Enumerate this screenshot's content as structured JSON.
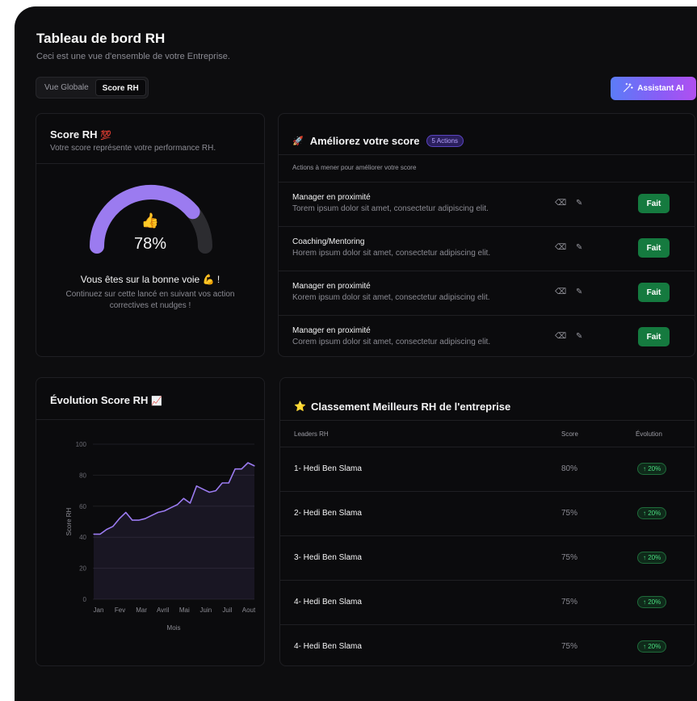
{
  "header": {
    "title": "Tableau de bord RH",
    "subtitle": "Ceci est une vue d'ensemble de votre Entreprise.",
    "tabs": [
      "Vue Globale",
      "Score RH"
    ],
    "active_tab": "Score RH",
    "ai_button": "Assistant AI"
  },
  "score_card": {
    "title": "Score RH",
    "title_emoji": "💯",
    "subtitle": "Votre score représente votre performance RH.",
    "emoji": "👍",
    "value": 78,
    "value_text": "78%",
    "status": "Vous êtes sur la bonne voie 💪 !",
    "message": "Continuez sur cette lancé en suivant vos action correctives et nudges !"
  },
  "actions": {
    "title_emoji": "🚀",
    "title": "Améliorez votre score",
    "badge": "5 Actions",
    "caption": "Actions à mener pour améliorer votre score",
    "done_label": "Fait",
    "items": [
      {
        "name": "Manager en proximité",
        "desc": "Torem ipsum dolor sit amet, consectetur adipiscing elit."
      },
      {
        "name": "Coaching/Mentoring",
        "desc": "Horem ipsum dolor sit amet, consectetur adipiscing elit."
      },
      {
        "name": "Manager en proximité",
        "desc": "Korem ipsum dolor sit amet, consectetur adipiscing elit."
      },
      {
        "name": "Manager en proximité",
        "desc": "Corem ipsum dolor sit amet, consectetur adipiscing elit."
      }
    ]
  },
  "evolution": {
    "title": "Évolution Score RH",
    "title_emoji": "📈"
  },
  "chart_data": {
    "type": "area",
    "x": [
      "Jan",
      "Fev",
      "Mar",
      "Avril",
      "Mai",
      "Juin",
      "Juil",
      "Aout"
    ],
    "xlabel": "Mois",
    "ylabel": "Score RH",
    "ylim": [
      0,
      100
    ],
    "yticks": [
      0,
      20,
      40,
      60,
      80,
      100
    ],
    "series": [
      {
        "values": [
          42,
          42,
          45,
          47,
          52,
          56,
          51,
          51,
          52,
          54,
          56,
          57,
          59,
          61,
          65,
          62,
          73,
          71,
          69,
          70,
          75,
          75,
          84,
          84,
          88,
          86
        ]
      }
    ],
    "color": "#9b7bf0"
  },
  "leaderboard": {
    "title_emoji": "⭐",
    "title": "Classement Meilleurs RH de l'entreprise",
    "columns": [
      "Leaders RH",
      "Score",
      "Évolution"
    ],
    "rows": [
      {
        "name": "1- Hedi Ben Slama",
        "score": "80%",
        "evolution": "↑ 20%"
      },
      {
        "name": "2- Hedi Ben Slama",
        "score": "75%",
        "evolution": "↑ 20%"
      },
      {
        "name": "3- Hedi Ben Slama",
        "score": "75%",
        "evolution": "↑ 20%"
      },
      {
        "name": "4- Hedi Ben Slama",
        "score": "75%",
        "evolution": "↑ 20%"
      },
      {
        "name": "4- Hedi Ben Slama",
        "score": "75%",
        "evolution": "↑ 20%"
      }
    ]
  }
}
